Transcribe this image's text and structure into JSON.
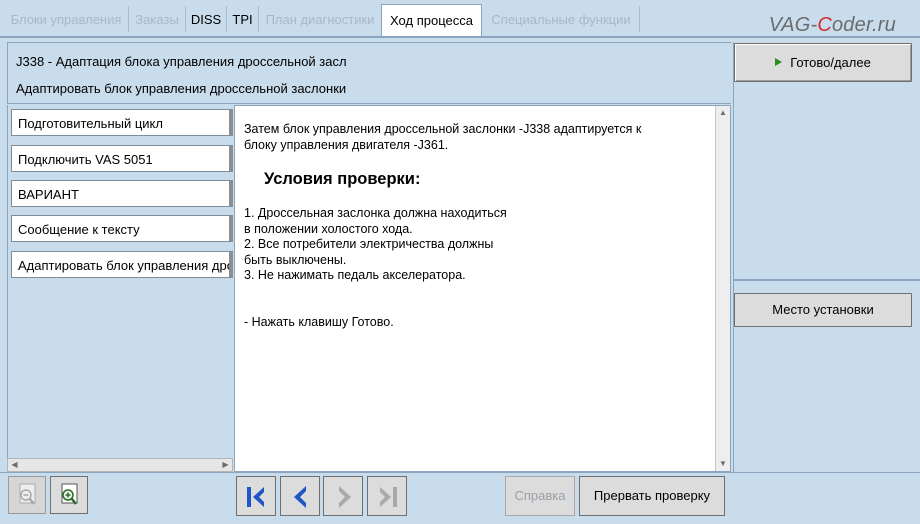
{
  "brand": {
    "pre": "VAG-",
    "c": "C",
    "post": "oder.ru"
  },
  "tabs": [
    {
      "label": "Блоки управления",
      "state": "disabled"
    },
    {
      "label": "Заказы",
      "state": "disabled"
    },
    {
      "label": "DISS",
      "state": "enabled"
    },
    {
      "label": "TPI",
      "state": "enabled"
    },
    {
      "label": "План диагностики",
      "state": "disabled"
    },
    {
      "label": "Ход процесса",
      "state": "active"
    },
    {
      "label": "Специальные функции",
      "state": "disabled"
    }
  ],
  "header": {
    "title": "J338 - Адаптация блока управления дроссельной засл",
    "subtitle": "Адаптировать блок управления дроссельной заслонки"
  },
  "steps": [
    "Подготовительный цикл",
    "Подключить VAS 5051",
    "ВАРИАНТ",
    "Сообщение к тексту",
    "Адаптировать блок управления дроссельной заслонки"
  ],
  "content": {
    "intro_line1": "Затем блок управления дроссельной заслонки -J338 адаптируется к",
    "intro_line2": "блоку управления двигателя -J361.",
    "conditions_heading": "Условия проверки:",
    "list_lines": [
      "1. Дроссельная заслонка должна находиться",
      "в положении холостого хода.",
      "2. Все потребители электричества  должны",
      "быть выключены.",
      "3. Не нажимать педаль акселератора."
    ],
    "press": "- Нажать клавишу Готово."
  },
  "right": {
    "go_label": "Готово/далее",
    "place_label": "Место установки"
  },
  "toolbar": {
    "help_label": "Справка",
    "abort_label": "Прервать проверку"
  },
  "colors": {
    "background": "#c9dcec",
    "border": "#8aa6bf",
    "nav_arrow": "#1f56c4",
    "go_triangle": "#2a8c1f",
    "brand_c": "#d42a2a"
  }
}
